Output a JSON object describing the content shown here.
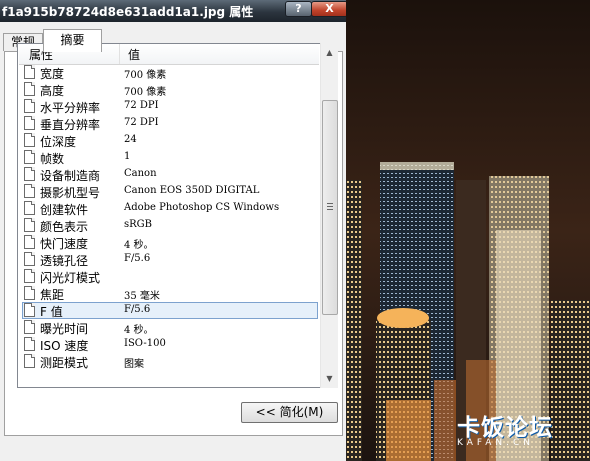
{
  "window": {
    "title": "f1a915b78724d8e631add1a1.jpg 属性",
    "help_glyph": "?",
    "close_glyph": "X"
  },
  "tabs": [
    {
      "label": "常规",
      "selected": false
    },
    {
      "label": "摘要",
      "selected": true
    }
  ],
  "list": {
    "col_property": "属性",
    "col_value": "值",
    "rows": [
      {
        "name": "宽度",
        "value": "700 像素"
      },
      {
        "name": "高度",
        "value": "700 像素"
      },
      {
        "name": "水平分辨率",
        "value": "72 DPI"
      },
      {
        "name": "垂直分辨率",
        "value": "72 DPI"
      },
      {
        "name": "位深度",
        "value": "24"
      },
      {
        "name": "帧数",
        "value": "1"
      },
      {
        "name": "设备制造商",
        "value": "Canon"
      },
      {
        "name": "摄影机型号",
        "value": "Canon EOS 350D DIGITAL"
      },
      {
        "name": "创建软件",
        "value": "Adobe Photoshop CS Windows"
      },
      {
        "name": "颜色表示",
        "value": "sRGB"
      },
      {
        "name": "快门速度",
        "value": "4 秒。"
      },
      {
        "name": "透镜孔径",
        "value": "F/5.6"
      },
      {
        "name": "闪光灯模式",
        "value": ""
      },
      {
        "name": "焦距",
        "value": "35 毫米"
      },
      {
        "name": "F 值",
        "value": "F/5.6"
      },
      {
        "name": "曝光时间",
        "value": "4 秒。"
      },
      {
        "name": "ISO 速度",
        "value": "ISO-100"
      },
      {
        "name": "测距模式",
        "value": "图案"
      }
    ],
    "selected_index": 14
  },
  "scrollbar": {
    "up_glyph": "▲",
    "down_glyph": "▼"
  },
  "buttons": {
    "simplify_label": "<< 简化(M)"
  },
  "watermark": {
    "text": "卡饭论坛",
    "sub": "KAFAN.CN"
  },
  "colors": {
    "title_bar": "#2c353f",
    "close_button": "#c0432b",
    "selection": "#e6f0fa",
    "watermark_blue": "#0d5aa7"
  }
}
